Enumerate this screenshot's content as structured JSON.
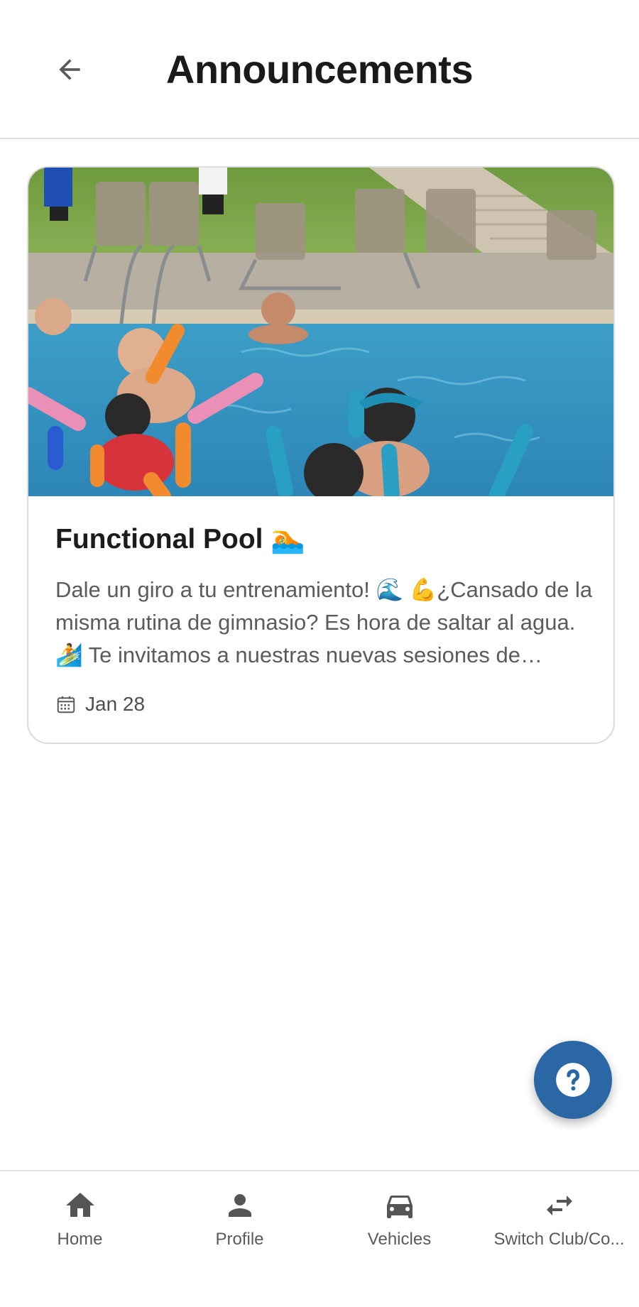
{
  "header": {
    "title": "Announcements",
    "back_icon": "arrow-left-icon"
  },
  "announcements": [
    {
      "title": "Functional Pool 🏊",
      "excerpt": "Dale un giro a tu entrenamiento! 🌊 💪¿Cansado de la misma rutina de gimnasio? Es hora de saltar al agua. 🏄 Te invitamos a nuestras nuevas sesiones de Functional Pool.",
      "date": "Jan 28",
      "date_icon": "calendar-icon",
      "image": "pool-photo"
    }
  ],
  "fab": {
    "icon": "help-icon",
    "color": "#2a67a4"
  },
  "bottom_nav": {
    "items": [
      {
        "label": "Home",
        "icon": "home-icon"
      },
      {
        "label": "Profile",
        "icon": "person-icon"
      },
      {
        "label": "Vehicles",
        "icon": "car-icon"
      },
      {
        "label": "Switch Club/Co...",
        "icon": "swap-icon"
      }
    ]
  },
  "colors": {
    "accent": "#2a67a4",
    "text_primary": "#1a1a1a",
    "text_secondary": "#5b5b5b",
    "divider": "#dedede"
  }
}
